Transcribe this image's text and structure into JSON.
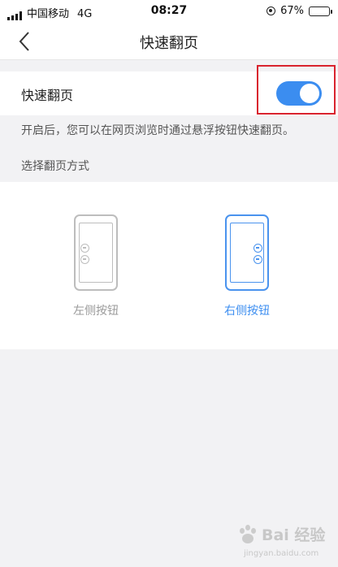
{
  "status_bar": {
    "carrier": "中国移动",
    "network": "4G",
    "time": "08:27",
    "battery": "67%",
    "battery_level": 0.67
  },
  "header": {
    "back_icon": "chevron-left-icon",
    "title": "快速翻页"
  },
  "setting": {
    "label": "快速翻页",
    "enabled": true,
    "toggle_color": "#3b8df0"
  },
  "description": "开启后，您可以在网页浏览时通过悬浮按钮快速翻页。",
  "mode_label": "选择翻页方式",
  "options": [
    {
      "label": "左侧按钮",
      "selected": false
    },
    {
      "label": "右侧按钮",
      "selected": true
    }
  ],
  "colors": {
    "accent": "#3b8df0",
    "highlight_box": "#d9232e",
    "inactive": "#9a9a9a"
  },
  "watermark": {
    "brand": "Bai 经验",
    "url": "jingyan.baidu.com"
  }
}
